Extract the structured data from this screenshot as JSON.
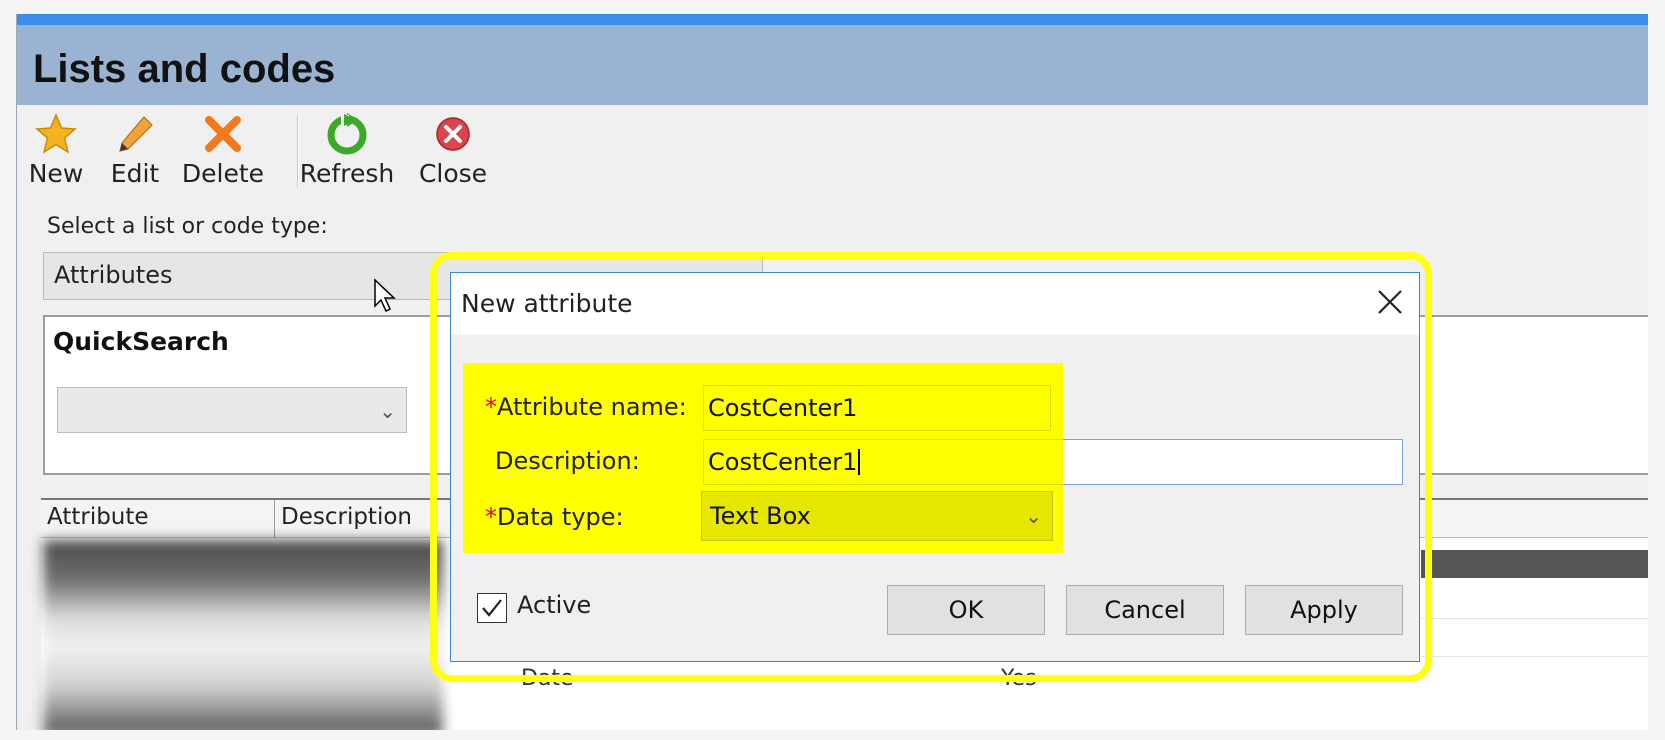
{
  "window": {
    "title": "Lists and codes"
  },
  "toolbar": {
    "new_label": "New",
    "edit_label": "Edit",
    "delete_label": "Delete",
    "refresh_label": "Refresh",
    "close_label": "Close"
  },
  "list_select": {
    "label": "Select a list or code type:",
    "value": "Attributes"
  },
  "quicksearch": {
    "title": "QuickSearch",
    "value": ""
  },
  "grid": {
    "columns": [
      "Attribute",
      "Description"
    ],
    "partial_cells": [
      "Date",
      "Yes"
    ]
  },
  "dialog": {
    "title": "New attribute",
    "required_marker": "*",
    "name_label": "Attribute name:",
    "name_value": "CostCenter1",
    "description_label": "Description:",
    "description_value": "CostCenter1",
    "datatype_label": "Data type:",
    "datatype_value": "Text Box",
    "active_label": "Active",
    "active_checked": true,
    "ok_label": "OK",
    "cancel_label": "Cancel",
    "apply_label": "Apply"
  },
  "colors": {
    "highlight": "#ffff00",
    "title_bar": "#9ab3d2",
    "accent_stripe": "#3b8ee8",
    "required": "#e0002a"
  },
  "icons": [
    "star-icon",
    "pencil-icon",
    "delete-x-icon",
    "refresh-icon",
    "close-circle-icon",
    "chevron-down-icon",
    "dialog-close-icon",
    "checkmark-icon",
    "mouse-cursor-icon"
  ]
}
